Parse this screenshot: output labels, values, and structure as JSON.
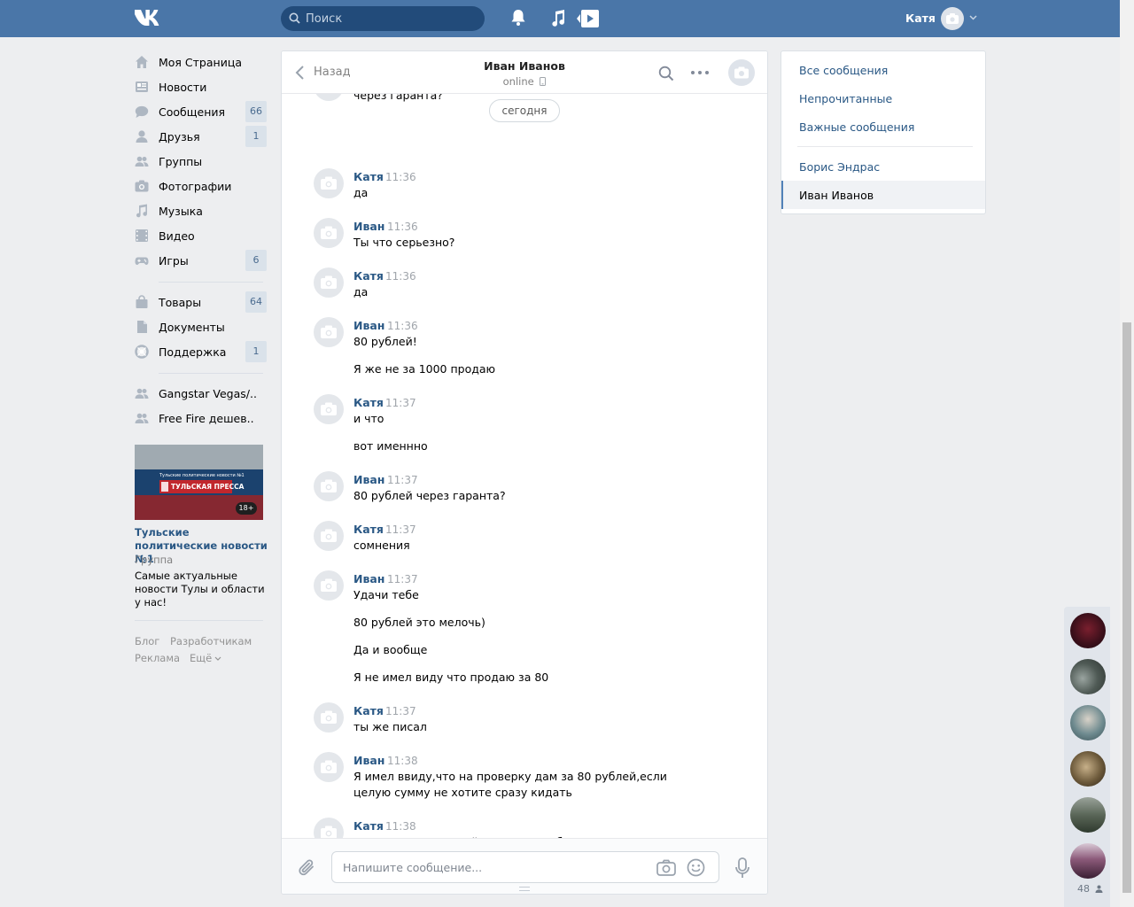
{
  "topbar": {
    "search_placeholder": "Поиск",
    "user_name": "Катя"
  },
  "left_menu": {
    "items": [
      {
        "label": "Моя Страница",
        "count": ""
      },
      {
        "label": "Новости",
        "count": ""
      },
      {
        "label": "Сообщения",
        "count": "66"
      },
      {
        "label": "Друзья",
        "count": "1"
      },
      {
        "label": "Группы",
        "count": ""
      },
      {
        "label": "Фотографии",
        "count": ""
      },
      {
        "label": "Музыка",
        "count": ""
      },
      {
        "label": "Видео",
        "count": ""
      },
      {
        "label": "Игры",
        "count": "6"
      }
    ],
    "items2": [
      {
        "label": "Товары",
        "count": "64"
      },
      {
        "label": "Документы",
        "count": ""
      },
      {
        "label": "Поддержка",
        "count": "1"
      }
    ],
    "groups": [
      {
        "label": "Gangstar Vegas/.."
      },
      {
        "label": "Free Fire дешев.."
      }
    ]
  },
  "ad": {
    "banner_small": "Тульские политические новости №1",
    "banner_big": "ТУЛЬСКАЯ ПРЕССА",
    "age": "18+",
    "title": "Тульские политические новости №1",
    "type": "Группа",
    "description": "Самые актуальные новости Тулы и области у нас!"
  },
  "footer": {
    "blog": "Блог",
    "developers": "Разработчикам",
    "ads": "Реклама",
    "more": "Ещё"
  },
  "chat": {
    "back_label": "Назад",
    "peer_name": "Иван Иванов",
    "peer_status": "online",
    "cut_text": "через гаранта?",
    "day_label": "сегодня",
    "messages": [
      {
        "author": "Катя",
        "time": "11:36",
        "lines": [
          "да"
        ]
      },
      {
        "author": "Иван",
        "time": "11:36",
        "lines": [
          "Ты что серьезно?"
        ]
      },
      {
        "author": "Катя",
        "time": "11:36",
        "lines": [
          "да"
        ]
      },
      {
        "author": "Иван",
        "time": "11:36",
        "lines": [
          "80 рублей!",
          "Я же не за 1000 продаю"
        ]
      },
      {
        "author": "Катя",
        "time": "11:37",
        "lines": [
          "и что",
          "вот именнно"
        ]
      },
      {
        "author": "Иван",
        "time": "11:37",
        "lines": [
          "80 рублей через гаранта?"
        ]
      },
      {
        "author": "Катя",
        "time": "11:37",
        "lines": [
          "сомнения"
        ]
      },
      {
        "author": "Иван",
        "time": "11:37",
        "lines": [
          "Удачи тебе",
          "80 рублей это мелочь)",
          "Да и вообще",
          "Я не имел виду что продаю за 80"
        ]
      },
      {
        "author": "Катя",
        "time": "11:37",
        "lines": [
          "ты же писал"
        ]
      },
      {
        "author": "Иван",
        "time": "11:38",
        "lines": [
          "Я имел ввиду,что на проверку дам за 80 рублей,если целую сумму не хотите сразу кидать"
        ]
      },
      {
        "author": "Катя",
        "time": "11:38",
        "lines": [
          "я понял кто ты такой,еще один дебил"
        ]
      }
    ],
    "composer_placeholder": "Напишите сообщение..."
  },
  "right_menu": {
    "all": "Все сообщения",
    "unread": "Непрочитанные",
    "important": "Важные сообщения",
    "peer1": "Борис Эндрас",
    "peer2": "Иван Иванов"
  },
  "side_chats": {
    "count": "48"
  },
  "colors": {
    "header": "#4a76a8",
    "link": "#2a5885",
    "background": "#edeef0"
  }
}
